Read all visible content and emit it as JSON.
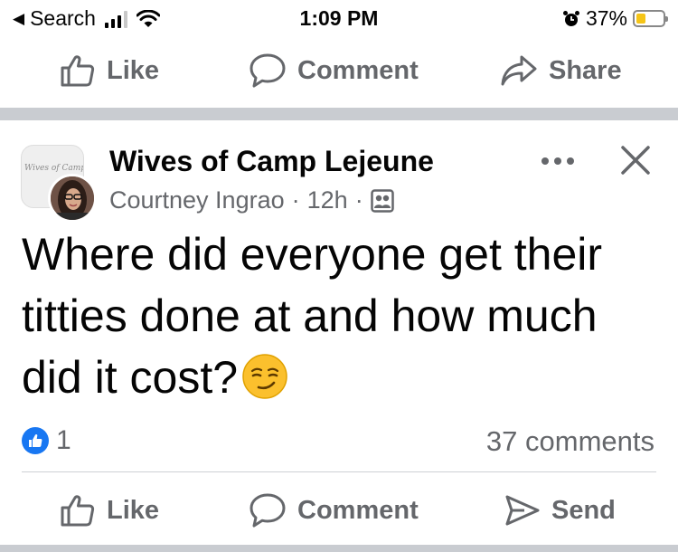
{
  "status_bar": {
    "back_label": "Search",
    "back_icon": "chevron-left-icon",
    "time": "1:09 PM",
    "battery_percent": "37%",
    "battery_level": 0.37,
    "battery_color": "#f5c518"
  },
  "top_actions": {
    "like_label": "Like",
    "comment_label": "Comment",
    "share_label": "Share"
  },
  "post": {
    "group_avatar_text": "Wives of Camp Lejeune",
    "group_name": "Wives of Camp Lejeune",
    "author": "Courtney Ingrao",
    "separator": "·",
    "time_ago": "12h",
    "audience_icon": "group-audience-icon",
    "text": "Where did everyone get their titties done at and how much did it cost?",
    "emoji_icon": "smirking-face-emoji",
    "like_count": "1",
    "comments_count": "37 comments"
  },
  "bottom_actions": {
    "like_label": "Like",
    "comment_label": "Comment",
    "send_label": "Send"
  },
  "colors": {
    "facebook_blue": "#1877f2",
    "secondary_text": "#65676b",
    "divider": "#c9ccd1"
  }
}
